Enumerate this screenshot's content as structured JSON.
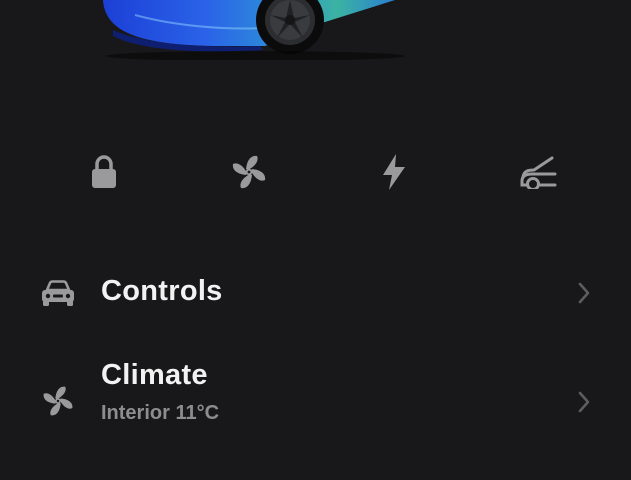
{
  "colors": {
    "background": "#18181a",
    "icon": "#9a9a9d",
    "title_text": "#f2f2f2",
    "subtitle_text": "#8d8d90",
    "chevron": "#5d5d60"
  },
  "vehicle_image": {
    "icon": "car-image"
  },
  "quick_actions": [
    {
      "id": "lock",
      "icon": "lock-icon"
    },
    {
      "id": "climate",
      "icon": "fan-icon"
    },
    {
      "id": "charge",
      "icon": "lightning-bolt-icon"
    },
    {
      "id": "frunk",
      "icon": "frunk-icon"
    }
  ],
  "menu": {
    "controls": {
      "title": "Controls",
      "icon": "car-icon",
      "chevron": "chevron-right-icon"
    },
    "climate": {
      "title": "Climate",
      "subtitle": "Interior 11°C",
      "icon": "fan-icon",
      "chevron": "chevron-right-icon"
    }
  }
}
